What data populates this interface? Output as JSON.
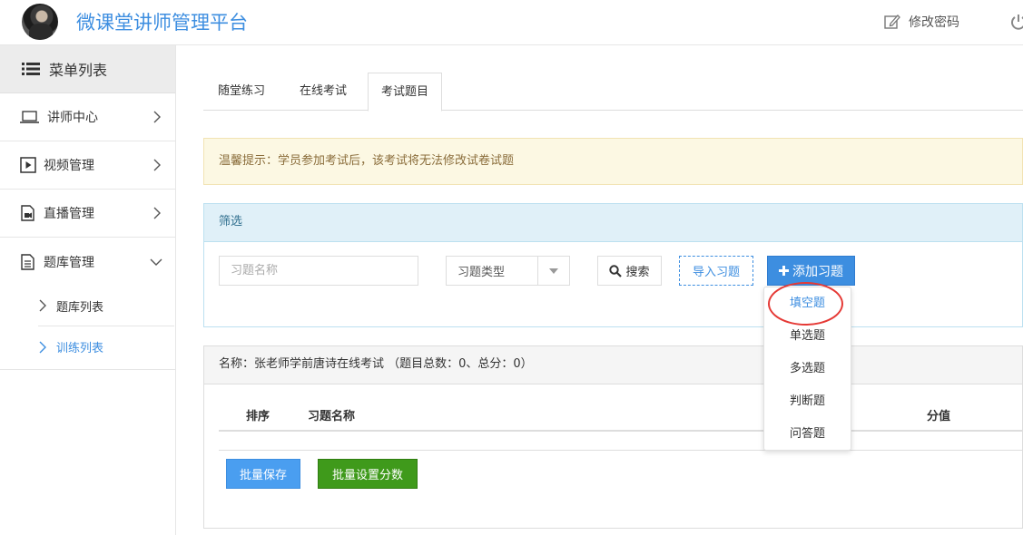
{
  "header": {
    "app_title": "微课堂讲师管理平台",
    "change_password": "修改密码"
  },
  "sidebar": {
    "menu_title": "菜单列表",
    "items": [
      {
        "label": "讲师中心",
        "icon": "laptop-icon"
      },
      {
        "label": "视频管理",
        "icon": "play-icon"
      },
      {
        "label": "直播管理",
        "icon": "live-icon"
      },
      {
        "label": "题库管理",
        "icon": "document-icon"
      }
    ],
    "subitems": [
      {
        "label": "题库列表"
      },
      {
        "label": "训练列表"
      }
    ]
  },
  "tabs": [
    {
      "label": "随堂练习"
    },
    {
      "label": "在线考试"
    },
    {
      "label": "考试题目"
    }
  ],
  "notice": "温馨提示：学员参加考试后，该考试将无法修改试卷试题",
  "filter": {
    "title": "筛选",
    "name_placeholder": "习题名称",
    "type_label": "习题类型",
    "search_label": "搜索",
    "import_label": "导入习题",
    "add_label": "添加习题"
  },
  "list": {
    "summary": "名称：张老师学前唐诗在线考试 （题目总数：0、总分：0）",
    "columns": {
      "order": "排序",
      "name": "习题名称",
      "score": "分值"
    },
    "batch_save": "批量保存",
    "batch_score": "批量设置分数"
  },
  "dropdown": {
    "items": [
      {
        "label": "填空题"
      },
      {
        "label": "单选题"
      },
      {
        "label": "多选题"
      },
      {
        "label": "判断题"
      },
      {
        "label": "问答题"
      }
    ]
  },
  "colors": {
    "accent": "#3d8ee0",
    "green": "#3f9a1b",
    "highlight": "#e53935"
  }
}
